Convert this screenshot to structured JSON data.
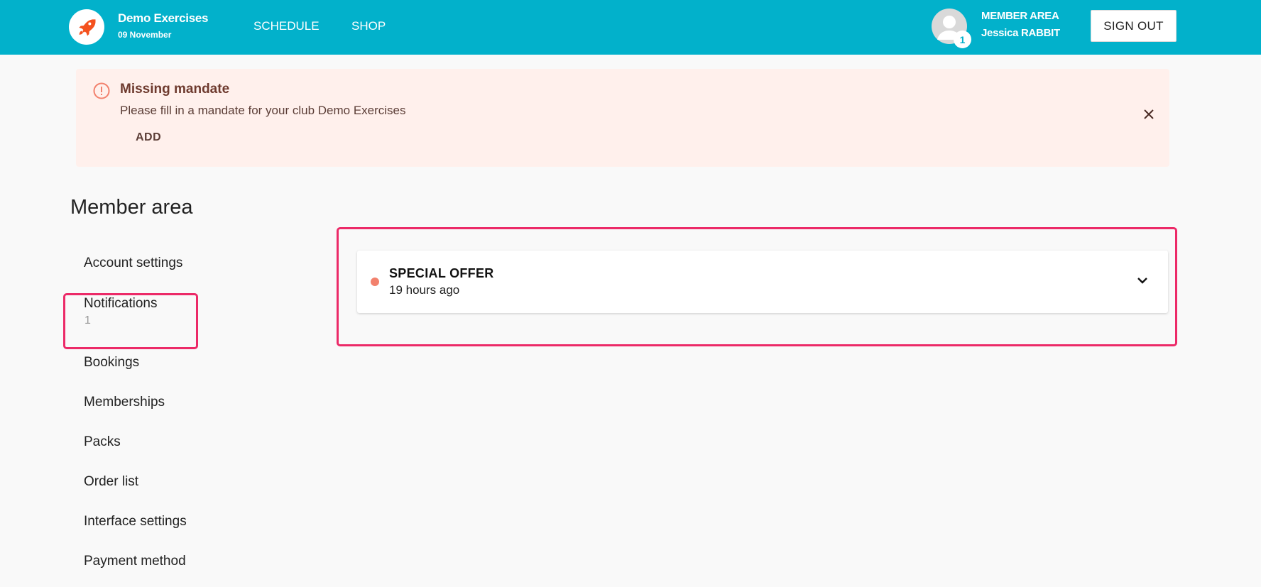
{
  "header": {
    "brand_name": "Demo Exercises",
    "brand_date": "09 November",
    "nav": [
      {
        "label": "SCHEDULE"
      },
      {
        "label": "SHOP"
      }
    ],
    "member_title": "MEMBER AREA",
    "member_name": "Jessica RABBIT",
    "notification_count": "1",
    "signout_label": "SIGN OUT",
    "colors": {
      "bar": "#02b1cb",
      "logo_icon": "#f4511e"
    }
  },
  "alert": {
    "title": "Missing mandate",
    "message": "Please fill in a mandate for your club Demo Exercises",
    "action_label": "ADD",
    "icon": "alert-circle-icon",
    "colors": {
      "background": "#fff0ec",
      "icon": "#f2816d"
    }
  },
  "sidebar": {
    "title": "Member area",
    "items": [
      {
        "label": "Account settings"
      },
      {
        "label": "Notifications",
        "count": "1"
      },
      {
        "label": "Bookings"
      },
      {
        "label": "Memberships"
      },
      {
        "label": "Packs"
      },
      {
        "label": "Order list"
      },
      {
        "label": "Interface settings"
      },
      {
        "label": "Payment method"
      }
    ]
  },
  "notifications": [
    {
      "title": "SPECIAL OFFER",
      "time": "19 hours ago",
      "unread": true
    }
  ],
  "highlight_color": "#ec2a68"
}
